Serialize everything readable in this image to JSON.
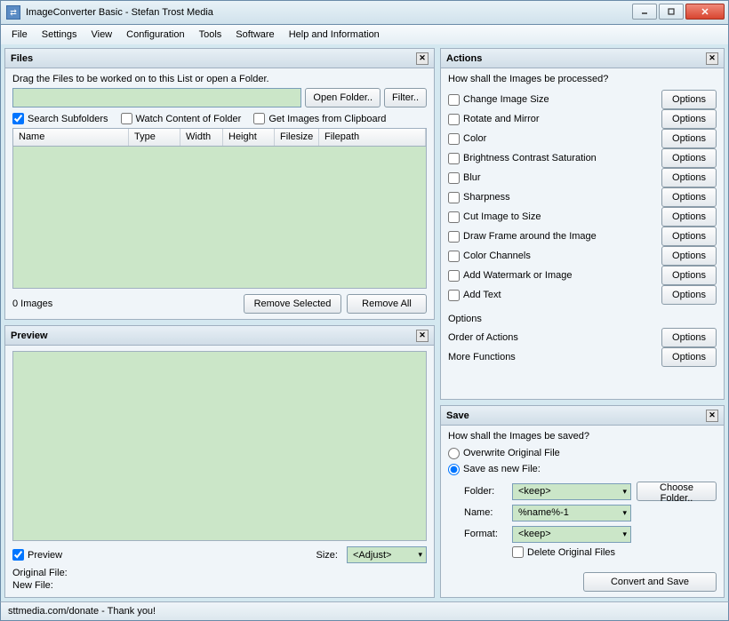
{
  "title": "ImageConverter Basic - Stefan Trost Media",
  "menu": [
    "File",
    "Settings",
    "View",
    "Configuration",
    "Tools",
    "Software",
    "Help and Information"
  ],
  "files": {
    "title": "Files",
    "drag_text": "Drag the Files to be worked on to this List or open a Folder.",
    "open_folder": "Open Folder..",
    "filter": "Filter..",
    "search_subfolders": "Search Subfolders",
    "watch_content": "Watch Content of Folder",
    "get_clipboard": "Get Images from Clipboard",
    "cols": {
      "name": "Name",
      "type": "Type",
      "width": "Width",
      "height": "Height",
      "filesize": "Filesize",
      "filepath": "Filepath"
    },
    "count": "0 Images",
    "remove_selected": "Remove Selected",
    "remove_all": "Remove All"
  },
  "preview": {
    "title": "Preview",
    "check": "Preview",
    "size_label": "Size:",
    "size_value": "<Adjust>",
    "original": "Original File:",
    "newfile": "New File:"
  },
  "actions": {
    "title": "Actions",
    "question": "How shall the Images be processed?",
    "items": [
      "Change Image Size",
      "Rotate and Mirror",
      "Color",
      "Brightness Contrast Saturation",
      "Blur",
      "Sharpness",
      "Cut Image to Size",
      "Draw Frame around the Image",
      "Color Channels",
      "Add Watermark or Image",
      "Add Text"
    ],
    "options_btn": "Options",
    "subhead": "Options",
    "order": "Order of Actions",
    "more": "More Functions"
  },
  "save": {
    "title": "Save",
    "question": "How shall the Images be saved?",
    "overwrite": "Overwrite Original File",
    "save_new": "Save as new File:",
    "folder_label": "Folder:",
    "folder_value": "<keep>",
    "choose_folder": "Choose Folder..",
    "name_label": "Name:",
    "name_value": "%name%-1",
    "format_label": "Format:",
    "format_value": "<keep>",
    "delete_orig": "Delete Original Files",
    "convert": "Convert and Save"
  },
  "status": "sttmedia.com/donate - Thank you!"
}
